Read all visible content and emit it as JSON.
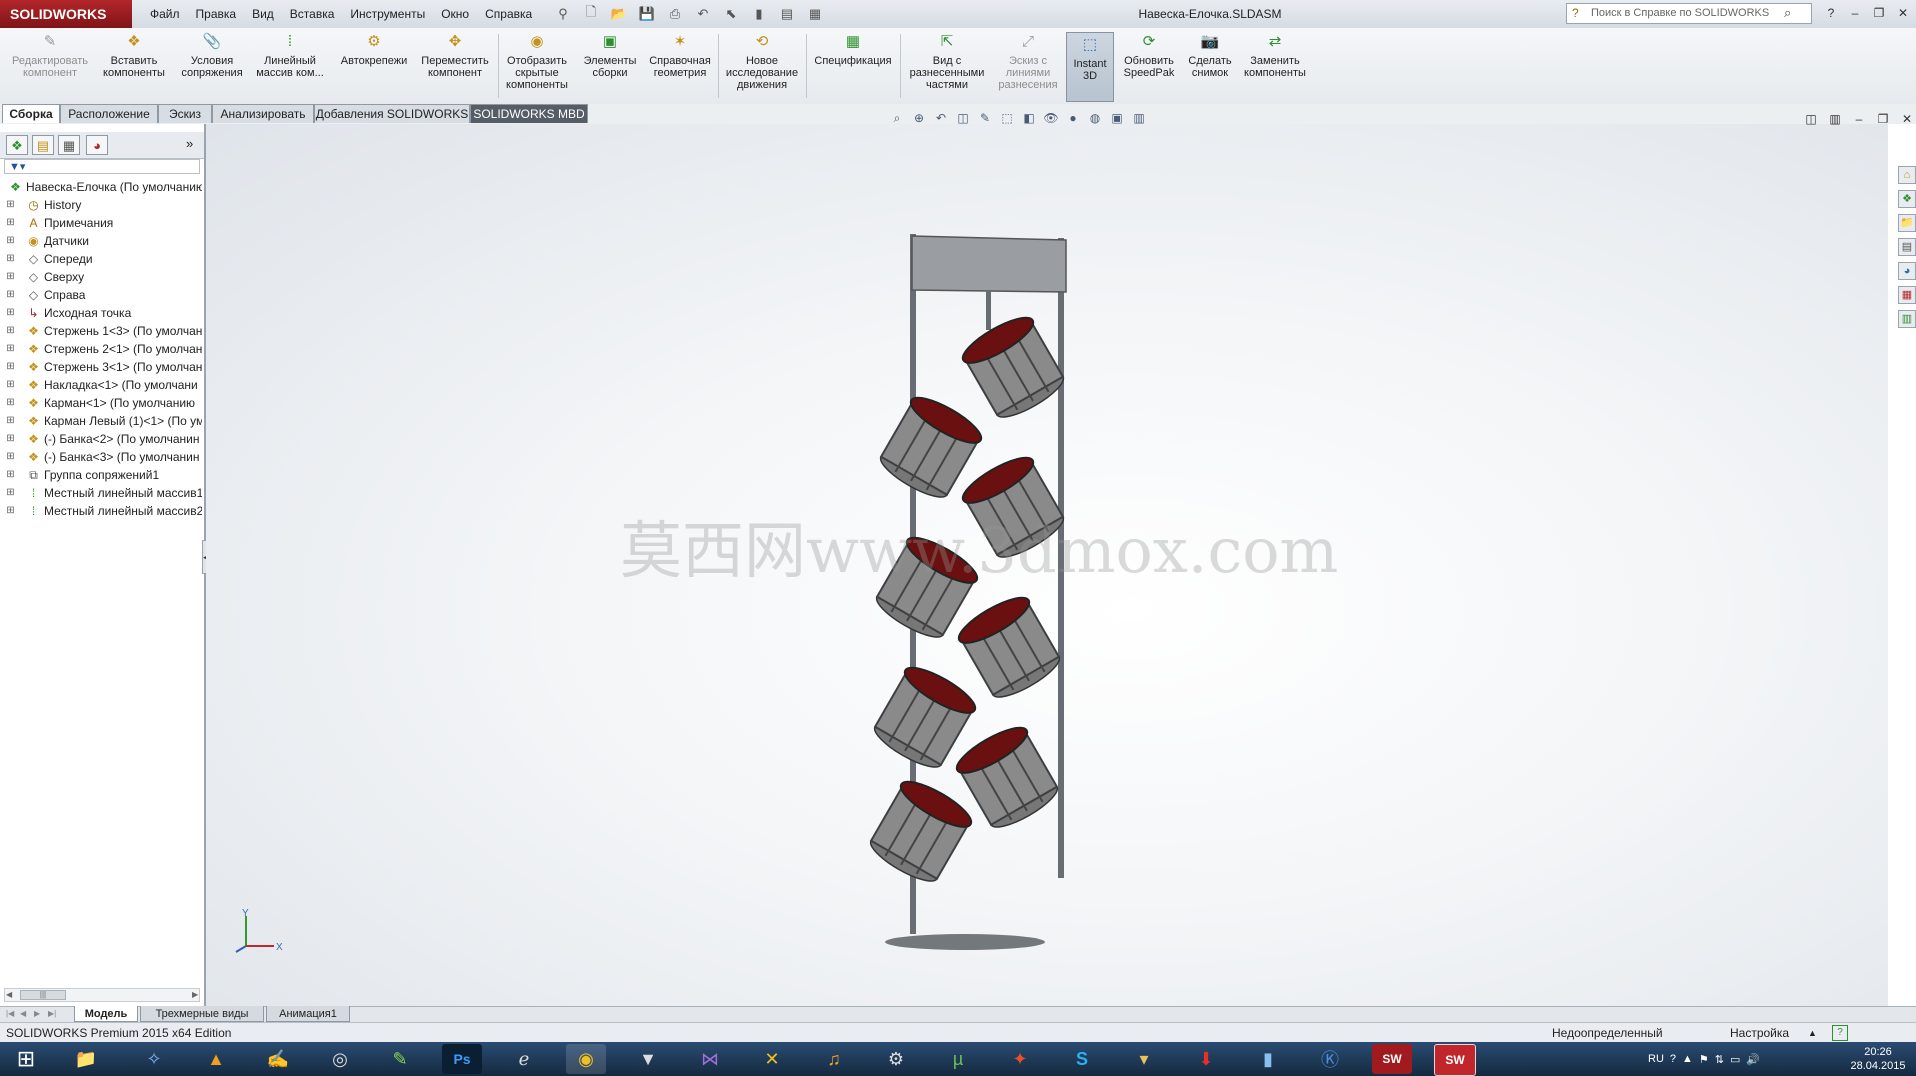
{
  "app": {
    "logo": "SOLIDWORKS",
    "document_title": "Навеска-Елочка.SLDASM",
    "search_placeholder": "Поиск в Справке по SOLIDWORKS"
  },
  "menu": [
    "Файл",
    "Правка",
    "Вид",
    "Вставка",
    "Инструменты",
    "Окно",
    "Справка"
  ],
  "command_manager": [
    {
      "label": "Редактировать компонент",
      "icon": "edit-component-icon",
      "state": "disabled"
    },
    {
      "label": "Вставить компоненты",
      "icon": "insert-components-icon",
      "state": "normal"
    },
    {
      "label": "Условия сопряжения",
      "icon": "mate-icon",
      "state": "normal"
    },
    {
      "label": "Линейный массив ком...",
      "icon": "linear-pattern-icon",
      "state": "normal"
    },
    {
      "label": "Автокрепежи",
      "icon": "smart-fasteners-icon",
      "state": "normal"
    },
    {
      "label": "Переместить компонент",
      "icon": "move-component-icon",
      "state": "normal"
    },
    {
      "label": "Отобразить скрытые компоненты",
      "icon": "show-hidden-icon",
      "state": "normal"
    },
    {
      "label": "Элементы сборки",
      "icon": "assembly-features-icon",
      "state": "normal"
    },
    {
      "label": "Справочная геометрия",
      "icon": "reference-geometry-icon",
      "state": "normal"
    },
    {
      "label": "Новое исследование движения",
      "icon": "motion-study-icon",
      "state": "normal"
    },
    {
      "label": "Спецификация",
      "icon": "bom-icon",
      "state": "normal"
    },
    {
      "label": "Вид с разнесенными частями",
      "icon": "exploded-view-icon",
      "state": "normal"
    },
    {
      "label": "Эскиз с линиями разнесения",
      "icon": "explode-line-sketch-icon",
      "state": "disabled"
    },
    {
      "label": "Instant 3D",
      "icon": "instant3d-icon",
      "state": "active"
    },
    {
      "label": "Обновить SpeedPak",
      "icon": "speedpak-icon",
      "state": "normal"
    },
    {
      "label": "Сделать снимок",
      "icon": "snapshot-icon",
      "state": "normal"
    },
    {
      "label": "Заменить компоненты",
      "icon": "replace-components-icon",
      "state": "normal"
    }
  ],
  "tabs": [
    "Сборка",
    "Расположение",
    "Эскиз",
    "Анализировать",
    "Добавления SOLIDWORKS",
    "SOLIDWORKS MBD"
  ],
  "tree": [
    {
      "label": "Навеска-Елочка  (По умолчанию",
      "level": 0,
      "icon": "assembly-icon"
    },
    {
      "label": "History",
      "level": 1,
      "icon": "history-icon"
    },
    {
      "label": "Примечания",
      "level": 1,
      "icon": "annotations-icon"
    },
    {
      "label": "Датчики",
      "level": 1,
      "icon": "sensors-icon"
    },
    {
      "label": "Спереди",
      "level": 1,
      "icon": "plane-icon"
    },
    {
      "label": "Сверху",
      "level": 1,
      "icon": "plane-icon"
    },
    {
      "label": "Справа",
      "level": 1,
      "icon": "plane-icon"
    },
    {
      "label": "Исходная точка",
      "level": 1,
      "icon": "origin-icon"
    },
    {
      "label": "Стержень 1<3> (По умолчан",
      "level": 1,
      "icon": "part-icon"
    },
    {
      "label": "Стержень 2<1> (По умолчан",
      "level": 1,
      "icon": "part-icon"
    },
    {
      "label": "Стержень 3<1> (По умолчан",
      "level": 1,
      "icon": "part-icon"
    },
    {
      "label": "Накладка<1> (По умолчани",
      "level": 1,
      "icon": "part-icon"
    },
    {
      "label": "Карман<1> (По умолчанию",
      "level": 1,
      "icon": "part-icon"
    },
    {
      "label": "Карман Левый (1)<1> (По ум",
      "level": 1,
      "icon": "part-icon"
    },
    {
      "label": "(-) Банка<2> (По умолчанин",
      "level": 1,
      "icon": "part-icon"
    },
    {
      "label": "(-) Банка<3> (По умолчанин",
      "level": 1,
      "icon": "part-icon"
    },
    {
      "label": "Группа сопряжений1",
      "level": 1,
      "icon": "mates-icon"
    },
    {
      "label": "Местный линейный массив1",
      "level": 1,
      "icon": "pattern-icon"
    },
    {
      "label": "Местный линейный массив2",
      "level": 1,
      "icon": "pattern-icon"
    }
  ],
  "viewport": {
    "watermark": "莫西网www.3dmox.com",
    "triad_y": "Y",
    "triad_x": "X"
  },
  "bottom_tabs": [
    "Модель",
    "Трехмерные виды",
    "Анимация1"
  ],
  "status": {
    "edition": "SOLIDWORKS Premium 2015 x64 Edition",
    "state": "Недоопределенный",
    "custom": "Настройка"
  },
  "tray": {
    "lang": "RU",
    "time": "20:26",
    "date": "28.04.2015"
  },
  "colors": {
    "brand": "#b3262a",
    "taskbar": "#1c3654",
    "can_body": "#8a8a8a",
    "can_rim": "#6b1010"
  }
}
